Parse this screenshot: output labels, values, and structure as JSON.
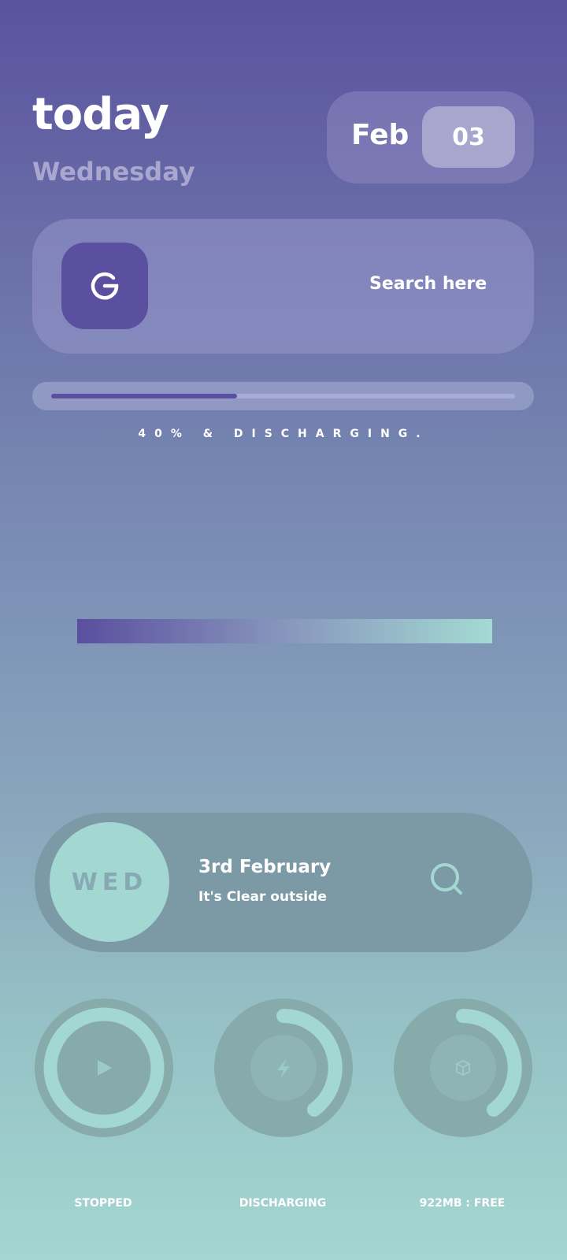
{
  "header": {
    "title": "today",
    "weekday": "Wednesday",
    "month": "Feb",
    "day": "03"
  },
  "search": {
    "logo_letter": "G",
    "label": "Search here"
  },
  "battery": {
    "level_percent": 40,
    "status_text": "40% & DISCHARGING."
  },
  "weather_card": {
    "day_short": "WED",
    "date_long": "3rd February",
    "condition": "It's Clear outside"
  },
  "rings": [
    {
      "icon": "play-icon",
      "label": "STOPPED"
    },
    {
      "icon": "bolt-icon",
      "label": "DISCHARGING"
    },
    {
      "icon": "box-icon",
      "label": "922MB : FREE"
    }
  ],
  "colors": {
    "accent_purple": "#5b4f9f",
    "accent_mint": "#a2d8d1",
    "ring_bg": "#87aaab"
  }
}
